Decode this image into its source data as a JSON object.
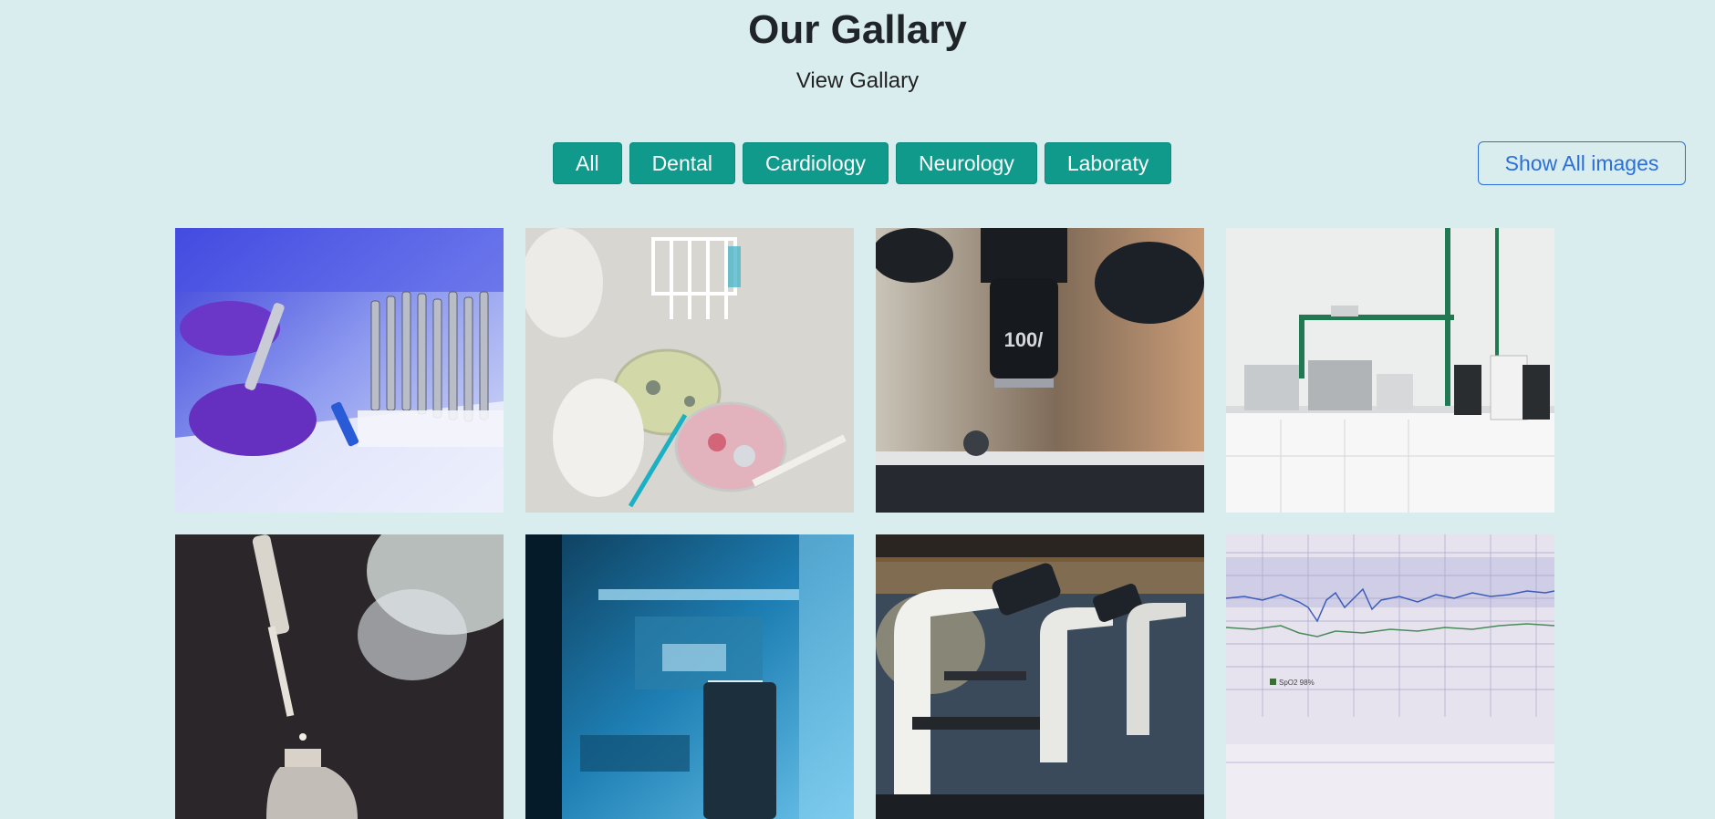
{
  "header": {
    "title": "Our Gallary",
    "subtitle": "View Gallary"
  },
  "filters": [
    {
      "label": "All"
    },
    {
      "label": "Dental"
    },
    {
      "label": "Cardiology"
    },
    {
      "label": "Neurology"
    },
    {
      "label": "Laboraty"
    }
  ],
  "show_all_label": "Show All images",
  "gallery": {
    "images": [
      {
        "subject": "gloved hands with lab tubes"
      },
      {
        "subject": "petri dishes in gloved hand"
      },
      {
        "subject": "microscope objective lens"
      },
      {
        "subject": "laboratory bench with equipment"
      },
      {
        "subject": "pipette dropper over bottle"
      },
      {
        "subject": "blue lab automation machine"
      },
      {
        "subject": "row of microscopes"
      },
      {
        "subject": "patient monitor chart"
      }
    ],
    "overlay_text": {
      "lens_marking": "100/",
      "monitor_label": "SpO2 98%"
    }
  },
  "colors": {
    "background": "#d9ecee",
    "filter_button": "#0f9a8c",
    "outline_button": "#2a6fdb"
  }
}
